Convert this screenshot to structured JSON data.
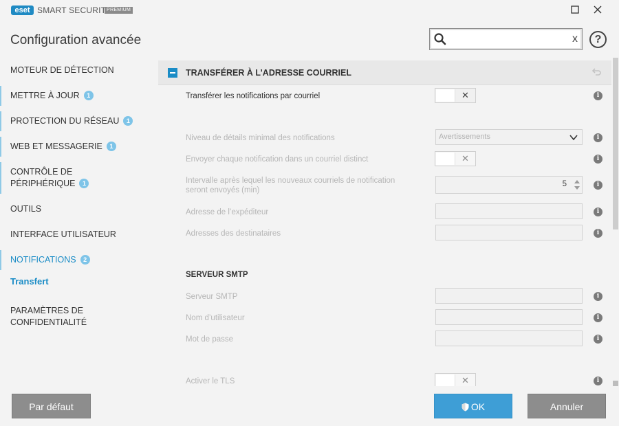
{
  "window": {
    "logo": "eset",
    "product": "SMART SECURITY",
    "edition": "PREMIUM",
    "maximize_icon": "☐",
    "close_icon": "✕"
  },
  "header": {
    "title": "Configuration avancée",
    "search_value": "",
    "search_clear": "x",
    "help": "?"
  },
  "sidebar": {
    "items": [
      {
        "label": "MOTEUR DE DÉTECTION",
        "badge": ""
      },
      {
        "label": "METTRE À JOUR",
        "badge": "1"
      },
      {
        "label": "PROTECTION DU RÉSEAU",
        "badge": "1"
      },
      {
        "label": "WEB ET MESSAGERIE",
        "badge": "1"
      },
      {
        "label_line1": "CONTRÔLE DE",
        "label_line2": "PÉRIPHÉRIQUE",
        "badge": "1"
      },
      {
        "label": "OUTILS",
        "badge": ""
      },
      {
        "label": "INTERFACE UTILISATEUR",
        "badge": ""
      },
      {
        "label": "NOTIFICATIONS",
        "badge": "2"
      },
      {
        "label": "Transfert"
      },
      {
        "label_line1": "PARAMÈTRES DE",
        "label_line2": "CONFIDENTIALITÉ",
        "badge": ""
      }
    ]
  },
  "content": {
    "section_title": "TRANSFÉRER À L’ADRESSE COURRIEL",
    "forward_label": "Transférer les notifications par courriel",
    "forward_state": "off",
    "min_detail_label": "Niveau de détails minimal des notifications",
    "min_detail_value": "Avertissements",
    "separate_label": "Envoyer chaque notification dans un courriel distinct",
    "separate_state": "off",
    "interval_label_line1": "Intervalle après lequel les nouveaux courriels de notification",
    "interval_label_line2": "seront envoyés (min)",
    "interval_value": "5",
    "sender_label": "Adresse de l’expéditeur",
    "recipients_label": "Adresses des destinataires",
    "smtp_heading": "SERVEUR SMTP",
    "smtp_server_label": "Serveur SMTP",
    "username_label": "Nom d’utilisateur",
    "password_label": "Mot de passe",
    "tls_label": "Activer le TLS",
    "tls_state": "off",
    "toggle_glyph": "✕",
    "info_glyph": "i"
  },
  "footer": {
    "default_label": "Par défaut",
    "ok_label": "OK",
    "cancel_label": "Annuler"
  },
  "colors": {
    "accent": "#1a8cc6",
    "ok_button": "#3e9ed6",
    "neutral_button": "#8d8d8d",
    "badge": "#7ec4e8"
  }
}
